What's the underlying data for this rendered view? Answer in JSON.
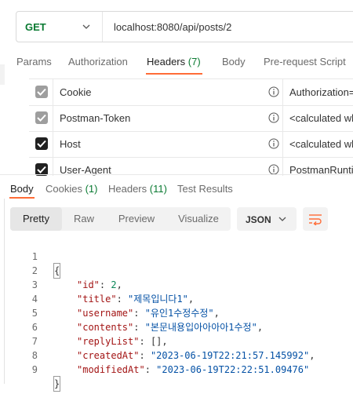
{
  "request": {
    "method": "GET",
    "url": "localhost:8080/api/posts/2"
  },
  "request_tabs": [
    {
      "label": "Params",
      "active": false
    },
    {
      "label": "Authorization",
      "active": false
    },
    {
      "label": "Headers",
      "count": "(7)",
      "active": true
    },
    {
      "label": "Body",
      "active": false
    },
    {
      "label": "Pre-request Script",
      "active": false
    }
  ],
  "headers": [
    {
      "key": "Cookie",
      "value": "Authorization=",
      "checked": true,
      "locked": true
    },
    {
      "key": "Postman-Token",
      "value": "<calculated wh",
      "checked": true,
      "locked": true
    },
    {
      "key": "Host",
      "value": "<calculated wh",
      "checked": true,
      "locked": false
    },
    {
      "key": "User-Agent",
      "value": "PostmanRuntim",
      "checked": true,
      "locked": false
    }
  ],
  "response_tabs": [
    {
      "label": "Body",
      "active": true
    },
    {
      "label": "Cookies",
      "count": "(1)",
      "active": false
    },
    {
      "label": "Headers",
      "count": "(11)",
      "active": false
    },
    {
      "label": "Test Results",
      "active": false
    }
  ],
  "format_buttons": [
    {
      "label": "Pretty",
      "active": true
    },
    {
      "label": "Raw",
      "active": false
    },
    {
      "label": "Preview",
      "active": false
    },
    {
      "label": "Visualize",
      "active": false
    }
  ],
  "language": "JSON",
  "body_lines": [
    {
      "n": "1",
      "open": "{"
    },
    {
      "n": "2",
      "key": "\"id\"",
      "value": "2",
      "type": "num",
      "comma": ","
    },
    {
      "n": "3",
      "key": "\"title\"",
      "value": "\"제목입니다1\"",
      "type": "str",
      "comma": ","
    },
    {
      "n": "4",
      "key": "\"username\"",
      "value": "\"유인1수정수정\"",
      "type": "str",
      "comma": ","
    },
    {
      "n": "5",
      "key": "\"contents\"",
      "value": "\"본문내용입아아아아1수정\"",
      "type": "str",
      "comma": ","
    },
    {
      "n": "6",
      "key": "\"replyList\"",
      "value": "[]",
      "type": "punct",
      "comma": ","
    },
    {
      "n": "7",
      "key": "\"createdAt\"",
      "value": "\"2023-06-19T22:21:57.145992\"",
      "type": "str",
      "comma": ","
    },
    {
      "n": "8",
      "key": "\"modifiedAt\"",
      "value": "\"2023-06-19T22:22:51.09476\"",
      "type": "str",
      "comma": ""
    },
    {
      "n": "9",
      "close": "}"
    }
  ],
  "colors": {
    "accent": "#ff6c37",
    "method_green": "#0a7a32",
    "json_key": "#a31515",
    "json_string": "#0451a5",
    "json_number": "#098658"
  },
  "icons": [
    "chevron-down-icon",
    "checkbox-icon",
    "info-icon",
    "wrap-lines-icon"
  ]
}
